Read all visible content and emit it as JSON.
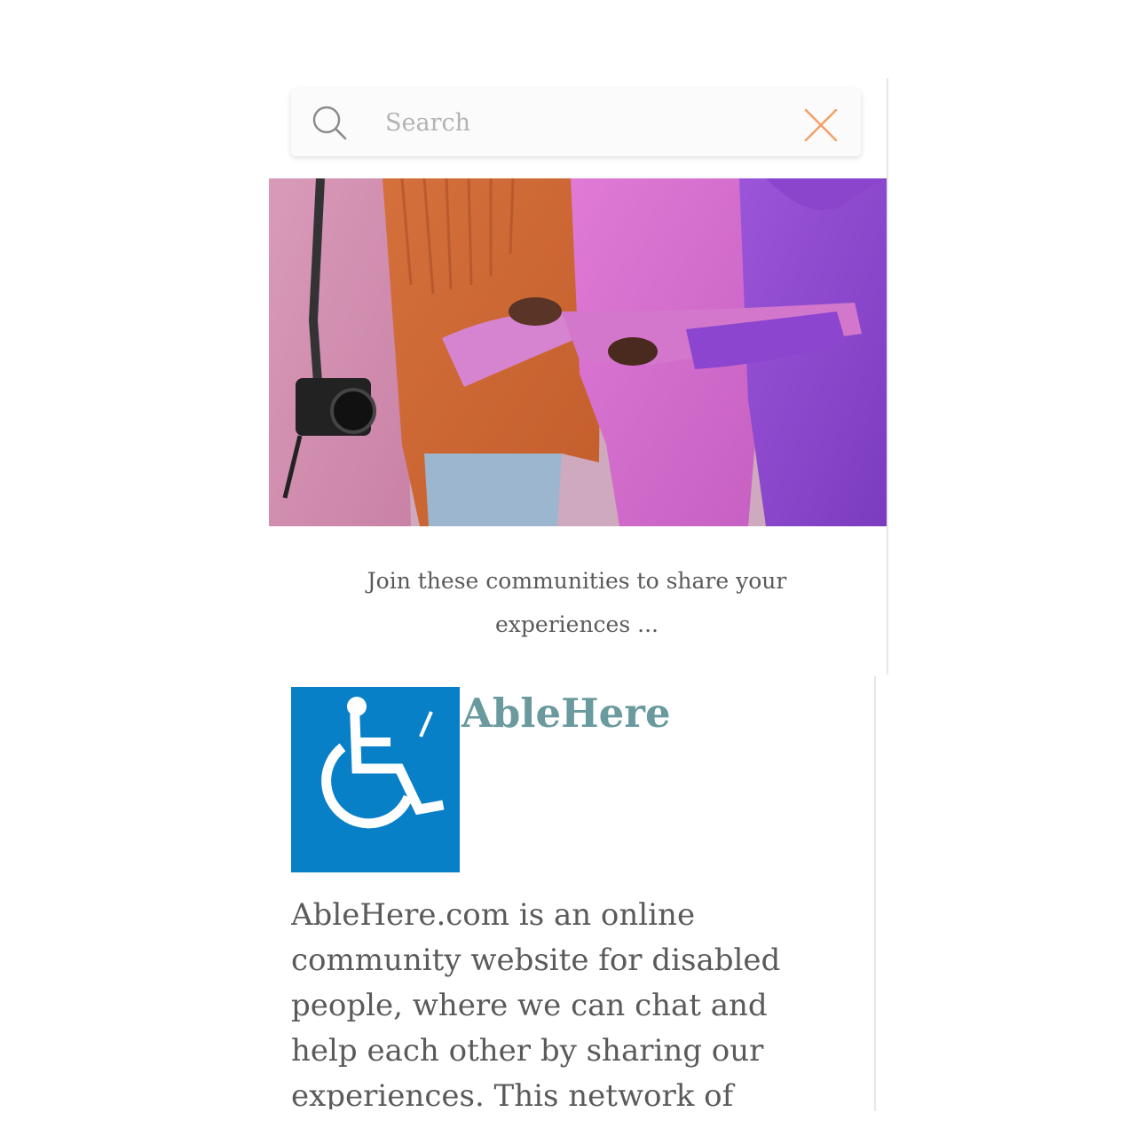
{
  "search": {
    "placeholder": "Search",
    "value": ""
  },
  "icons": {
    "search": "search-icon",
    "close": "close-icon",
    "community_logo": "wheelchair-icon"
  },
  "colors": {
    "close_icon": "#f2a26a",
    "community_title": "#6a9a9e",
    "logo_bg": "#0780c8",
    "body_text": "#5a5a5a"
  },
  "main": {
    "caption": "Join these communities to share your experiences ...",
    "community": {
      "name": "AbleHere",
      "description": "AbleHere.com is an online community website for disabled people, where we can chat and help each other by sharing our experiences. This network of"
    }
  }
}
